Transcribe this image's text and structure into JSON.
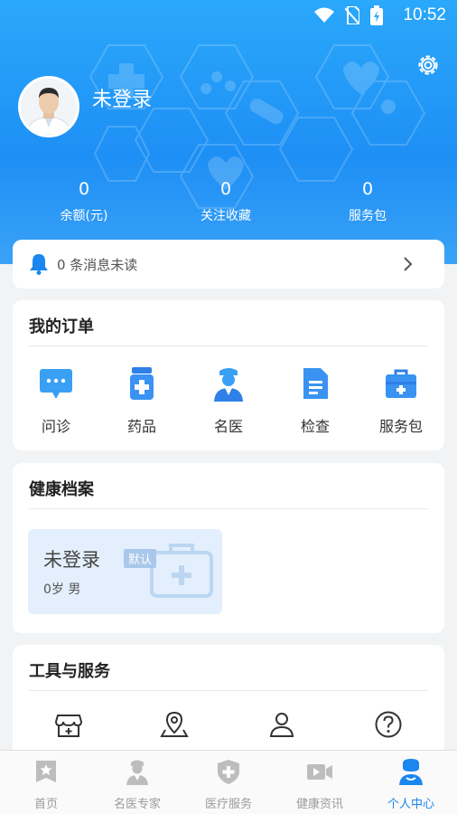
{
  "status_bar": {
    "time": "10:52"
  },
  "profile": {
    "username": "未登录"
  },
  "stats": [
    {
      "value": "0",
      "label": "余额(元)"
    },
    {
      "value": "0",
      "label": "关注收藏"
    },
    {
      "value": "0",
      "label": "服务包"
    }
  ],
  "messages": {
    "text": "0 条消息未读"
  },
  "orders": {
    "title": "我的订单",
    "items": [
      {
        "label": "问诊",
        "icon": "chat-bubble-icon"
      },
      {
        "label": "药品",
        "icon": "medicine-bottle-icon"
      },
      {
        "label": "名医",
        "icon": "doctor-icon"
      },
      {
        "label": "检查",
        "icon": "document-icon"
      },
      {
        "label": "服务包",
        "icon": "medical-kit-icon"
      }
    ]
  },
  "health": {
    "title": "健康档案",
    "name": "未登录",
    "badge": "默认",
    "info": "0岁  男"
  },
  "tools": {
    "title": "工具与服务",
    "icons": [
      "store-icon",
      "location-pin-icon",
      "person-icon",
      "help-circle-icon"
    ]
  },
  "tabbar": {
    "items": [
      {
        "label": "首页",
        "icon": "home-star-icon",
        "active": false
      },
      {
        "label": "名医专家",
        "icon": "doctor-icon",
        "active": false
      },
      {
        "label": "医疗服务",
        "icon": "shield-plus-icon",
        "active": false
      },
      {
        "label": "健康资讯",
        "icon": "video-camera-icon",
        "active": false
      },
      {
        "label": "个人中心",
        "icon": "person-icon",
        "active": true
      }
    ]
  },
  "colors": {
    "primary": "#1e8ff5",
    "active_tab": "#1a86f0",
    "background": "#f2f3f5"
  }
}
